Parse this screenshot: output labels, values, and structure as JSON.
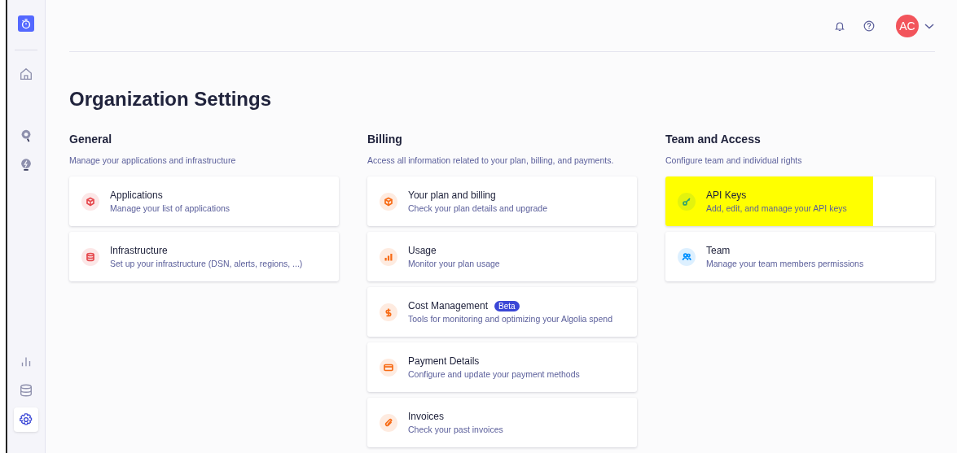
{
  "sidebar": {
    "items": [
      {
        "kind": "home",
        "selected": false
      },
      {
        "kind": "search",
        "selected": false
      },
      {
        "kind": "bulb",
        "selected": false
      },
      {
        "kind": "chart",
        "selected": false
      },
      {
        "kind": "database",
        "selected": false
      },
      {
        "kind": "gear",
        "selected": true
      }
    ]
  },
  "header": {
    "avatar": "AC"
  },
  "title": "Organization Settings",
  "sections": [
    {
      "heading": "General",
      "description": "Manage your applications and infrastructure",
      "cards": [
        {
          "kind": "cube",
          "color": "#e5484d",
          "title": "Applications",
          "subtitle": "Manage your list of applications",
          "highlighted": false
        },
        {
          "kind": "database",
          "color": "#e5484d",
          "title": "Infrastructure",
          "subtitle": "Set up your infrastructure (DSN, alerts, regions, ...)",
          "highlighted": false
        }
      ]
    },
    {
      "heading": "Billing",
      "description": "Access all information related to your plan, billing, and payments.",
      "cards": [
        {
          "kind": "cube",
          "color": "#f76b15",
          "title": "Your plan and billing",
          "subtitle": "Check your plan details and upgrade",
          "highlighted": false
        },
        {
          "kind": "bars",
          "color": "#f76b15",
          "title": "Usage",
          "subtitle": "Monitor your plan usage",
          "highlighted": false
        },
        {
          "kind": "dollar",
          "color": "#f76b15",
          "title": "Cost Management",
          "badge": "Beta",
          "subtitle": "Tools for monitoring and optimizing your Algolia spend",
          "highlighted": false
        },
        {
          "kind": "card",
          "color": "#f76b15",
          "title": "Payment Details",
          "subtitle": "Configure and update your payment methods",
          "highlighted": false
        },
        {
          "kind": "clip",
          "color": "#f76b15",
          "title": "Invoices",
          "subtitle": "Check your past invoices",
          "highlighted": false
        }
      ]
    },
    {
      "heading": "Team and Access",
      "description": "Configure team and individual rights",
      "cards": [
        {
          "kind": "key",
          "color": "#30a46c",
          "title": "API Keys",
          "subtitle": "Add, edit, and manage your API keys",
          "highlighted": true
        },
        {
          "kind": "people",
          "color": "#0090ff",
          "title": "Team",
          "subtitle": "Manage your team members permissions",
          "highlighted": false
        }
      ]
    }
  ]
}
